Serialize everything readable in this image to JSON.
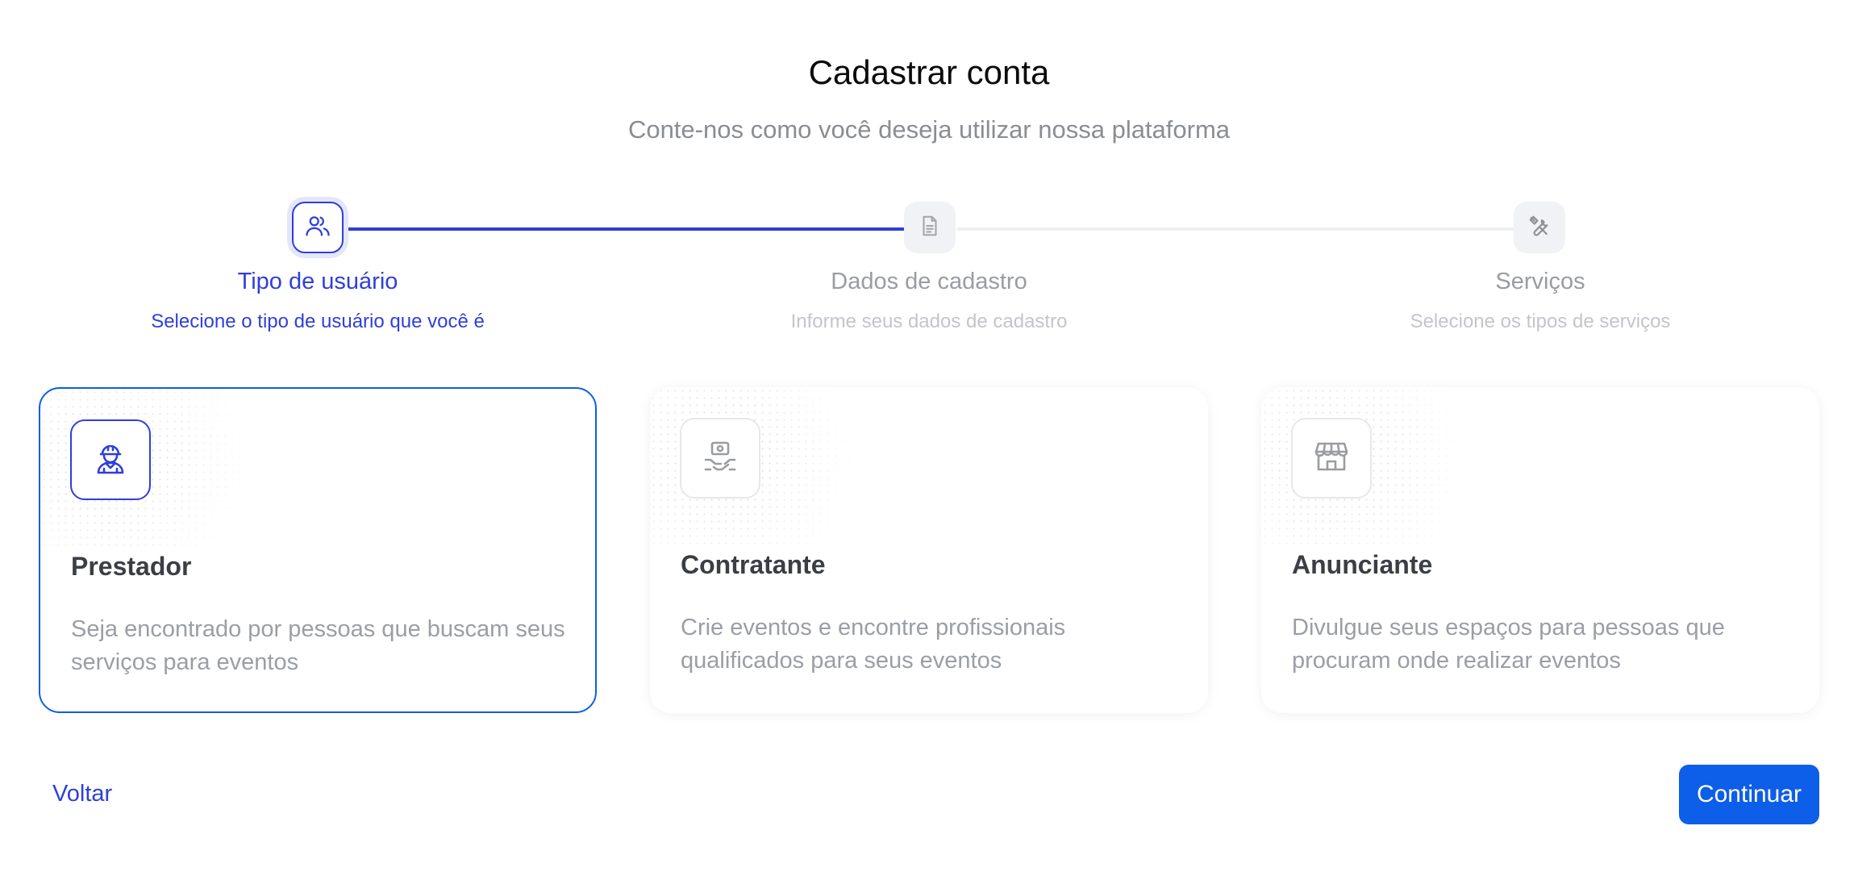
{
  "header": {
    "title": "Cadastrar conta",
    "subtitle": "Conte-nos como você deseja utilizar nossa plataforma"
  },
  "stepper": {
    "steps": [
      {
        "title": "Tipo de usuário",
        "description": "Selecione o tipo de usuário que você é",
        "icon": "users-icon",
        "state": "active"
      },
      {
        "title": "Dados de cadastro",
        "description": "Informe seus dados de cadastro",
        "icon": "document-icon",
        "state": "inactive"
      },
      {
        "title": "Serviços",
        "description": "Selecione os tipos de serviços",
        "icon": "tools-icon",
        "state": "inactive"
      }
    ]
  },
  "cards": [
    {
      "title": "Prestador",
      "description": "Seja encontrado por pessoas que buscam seus serviços para eventos",
      "icon": "worker-icon",
      "selected": true
    },
    {
      "title": "Contratante",
      "description": "Crie eventos e encontre profissionais qualificados para seus eventos",
      "icon": "handshake-icon",
      "selected": false
    },
    {
      "title": "Anunciante",
      "description": "Divulgue seus espaços para pessoas que procuram onde realizar eventos",
      "icon": "storefront-icon",
      "selected": false
    }
  ],
  "actions": {
    "back_label": "Voltar",
    "continue_label": "Continuar"
  },
  "colors": {
    "accent": "#2f3fd8",
    "primary_button": "#0d5ee8",
    "muted_text": "#9b9ea5"
  }
}
